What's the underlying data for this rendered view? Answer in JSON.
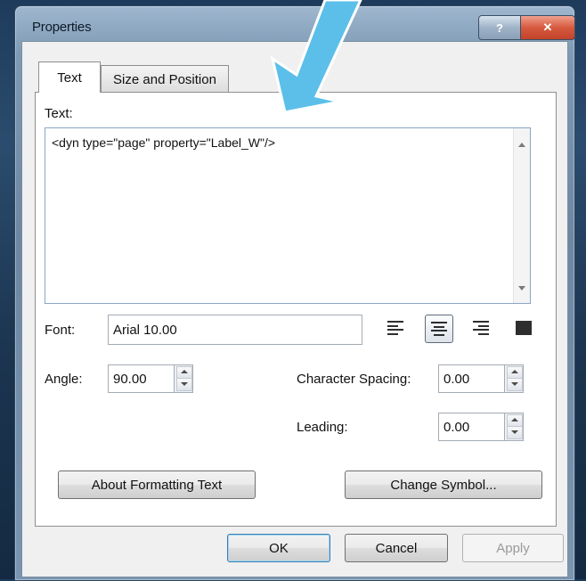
{
  "window": {
    "title": "Properties",
    "help_label": "?",
    "close_label": "✕"
  },
  "tabs": [
    {
      "label": "Text",
      "active": true
    },
    {
      "label": "Size and Position",
      "active": false
    }
  ],
  "text_field": {
    "label": "Text:",
    "value": "<dyn type=\"page\" property=\"Label_W\"/>"
  },
  "font": {
    "label": "Font:",
    "value": "Arial 10.00"
  },
  "alignment": {
    "options": [
      {
        "name": "align-left-icon",
        "active": false
      },
      {
        "name": "align-center-icon",
        "active": true
      },
      {
        "name": "align-right-icon",
        "active": false
      },
      {
        "name": "align-justify-icon",
        "active": false
      }
    ]
  },
  "angle": {
    "label": "Angle:",
    "value": "90.00"
  },
  "character_spacing": {
    "label": "Character Spacing:",
    "value": "0.00"
  },
  "leading": {
    "label": "Leading:",
    "value": "0.00"
  },
  "buttons": {
    "about_formatting": "About Formatting Text",
    "change_symbol": "Change Symbol...",
    "ok": "OK",
    "cancel": "Cancel",
    "apply": "Apply"
  },
  "colors": {
    "annotation_arrow": "#5bbfea"
  }
}
